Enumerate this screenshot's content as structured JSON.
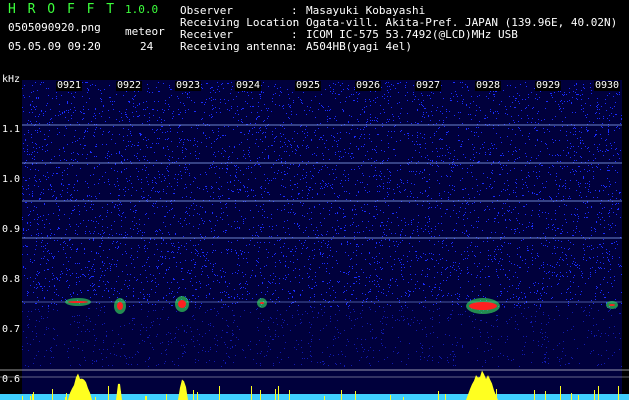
{
  "app": {
    "name": "H R O F F T",
    "version": "1.0.0",
    "filename": "0505090920.png",
    "datetime": "05.05.09 09:20",
    "meteor_label": "meteor",
    "meteor_count": "24"
  },
  "header": {
    "rows": [
      {
        "label": "Observer",
        "colon": ":",
        "value": "Masayuki Kobayashi"
      },
      {
        "label": "Receiving Location",
        "colon": ":",
        "value": "Ogata-vill. Akita-Pref. JAPAN (139.96E, 40.02N)"
      },
      {
        "label": "Receiver",
        "colon": ":",
        "value": "ICOM IC-575 53.7492(@LCD)MHz USB"
      },
      {
        "label": "Receiving antenna",
        "colon": ":",
        "value": "A504HB(yagi 4el)"
      }
    ]
  },
  "spectrogram": {
    "y_unit": "kHz",
    "y_ticks": [
      "1.1",
      "1.0",
      "0.9",
      "0.8",
      "0.7",
      "0.6"
    ],
    "x_ticks": [
      "0921",
      "0922",
      "0923",
      "0924",
      "0925",
      "0926",
      "0927",
      "0928",
      "0929",
      "0930"
    ],
    "colors": {
      "background": "#00003c",
      "noise": "#1a2cff",
      "line": "#8fb0ff",
      "echo_hot": "#ff2020",
      "echo_mid": "#40ff60",
      "histogram": "#ffff20",
      "baseline": "#40d0ff"
    }
  }
}
